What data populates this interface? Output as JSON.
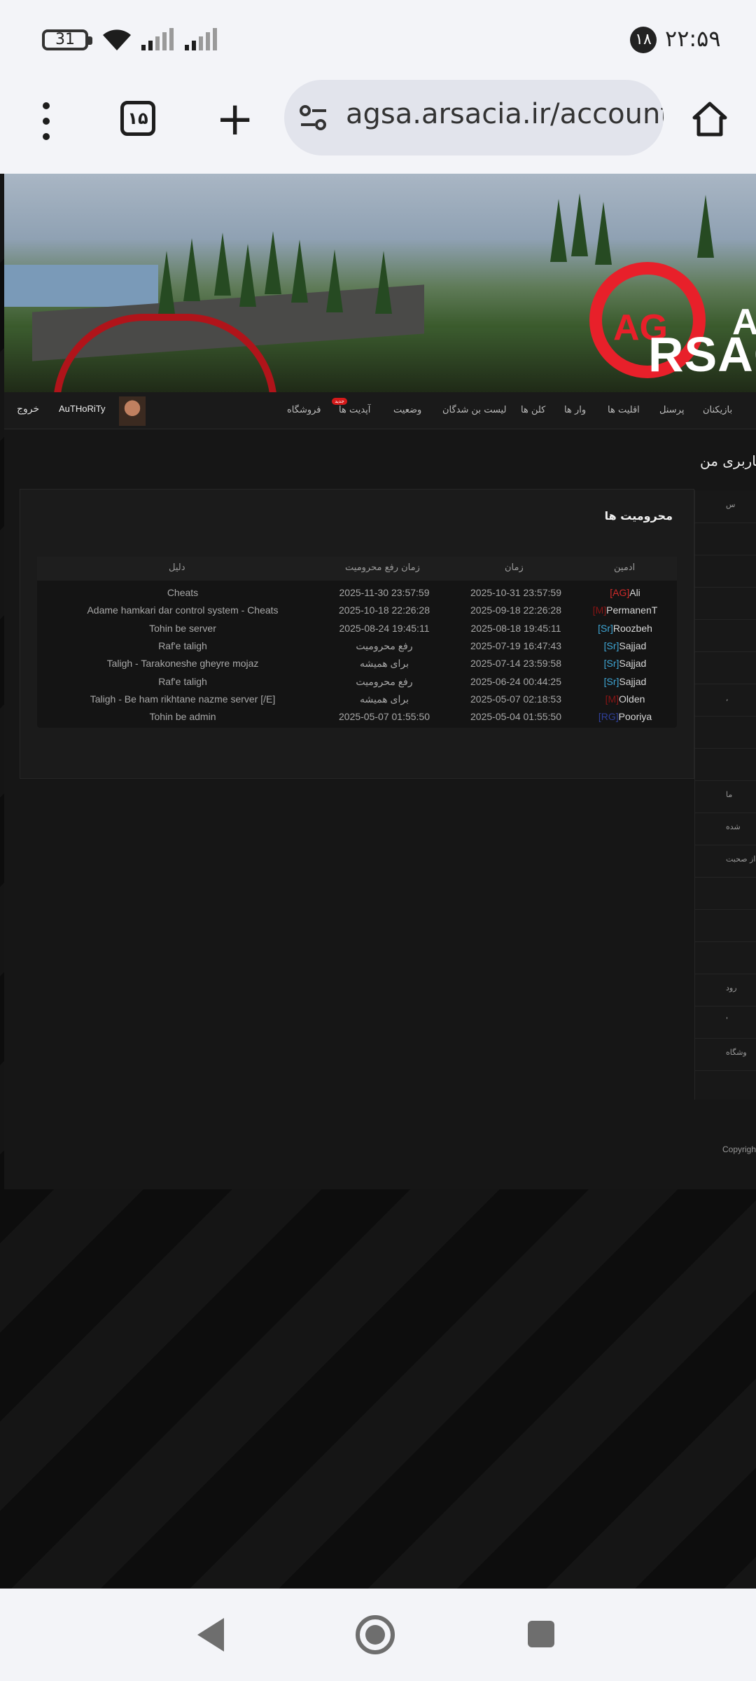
{
  "status_bar": {
    "battery": "31",
    "notification_count": "۱۸",
    "time": "۲۲:۵۹"
  },
  "browser": {
    "tab_count": "۱۵",
    "url": "agsa.arsacia.ir/account"
  },
  "site": {
    "logo_text": "RSAC",
    "logo_ag": "AG",
    "logo_a": "A",
    "nav": {
      "logout": "خروج",
      "username": "AuTHoRiTy",
      "new_badge": "جدید",
      "items": [
        "فروشگاه",
        "آپدیت ها",
        "وضعیت",
        "لیست بن شدگان",
        "کلن ها",
        "وار ها",
        "اقلیت ها",
        "پرسنل",
        "بازیکنان"
      ]
    },
    "page_heading": "کاربری من",
    "bans_panel": {
      "title": "محرومیت ها",
      "headers": {
        "reason": "دلیل",
        "unban_time": "زمان رفع محرومیت",
        "time": "زمان",
        "admin": "ادمین"
      },
      "rows": [
        {
          "admin_tag": "[AG]",
          "admin_name": "Ali",
          "tag_color": "#d02a2a",
          "time": "2025-10-31 23:57:59",
          "unban": "2025-11-30 23:57:59",
          "reason": "Cheats"
        },
        {
          "admin_tag": "[M]",
          "admin_name": "PermanenT",
          "tag_color": "#8a1515",
          "time": "2025-09-18 22:26:28",
          "unban": "2025-10-18 22:26:28",
          "reason": "Adame hamkari dar control system - Cheats"
        },
        {
          "admin_tag": "[Sr]",
          "admin_name": "Roozbeh",
          "tag_color": "#3fa7d6",
          "time": "2025-08-18 19:45:11",
          "unban": "2025-08-24 19:45:11",
          "reason": "Tohin be server"
        },
        {
          "admin_tag": "[Sr]",
          "admin_name": "Sajjad",
          "tag_color": "#3fa7d6",
          "time": "2025-07-19 16:47:43",
          "unban": "رفع محرومیت",
          "reason": "Raf'e taligh"
        },
        {
          "admin_tag": "[Sr]",
          "admin_name": "Sajjad",
          "tag_color": "#3fa7d6",
          "time": "2025-07-14 23:59:58",
          "unban": "برای همیشه",
          "reason": "Taligh - Tarakoneshe gheyre mojaz"
        },
        {
          "admin_tag": "[Sr]",
          "admin_name": "Sajjad",
          "tag_color": "#3fa7d6",
          "time": "2025-06-24 00:44:25",
          "unban": "رفع محرومیت",
          "reason": "Raf'e taligh"
        },
        {
          "admin_tag": "[M]",
          "admin_name": "Olden",
          "tag_color": "#8a1515",
          "time": "2025-05-07 02:18:53",
          "unban": "برای همیشه",
          "reason": "Taligh - Be ham rikhtane nazme server [/E]"
        },
        {
          "admin_tag": "[RG]",
          "admin_name": "Pooriya",
          "tag_color": "#2f3f9a",
          "time": "2025-05-04 01:55:50",
          "unban": "2025-05-07 01:55:50",
          "reason": "Tohin be admin"
        }
      ]
    },
    "sidebar_items": [
      "س",
      "",
      "",
      "",
      "",
      "",
      ",",
      "",
      "",
      "ما",
      "شده",
      "از صحبت",
      "",
      "",
      "",
      "رود",
      "'",
      "وشگاه"
    ],
    "copyright": "Copyright"
  }
}
